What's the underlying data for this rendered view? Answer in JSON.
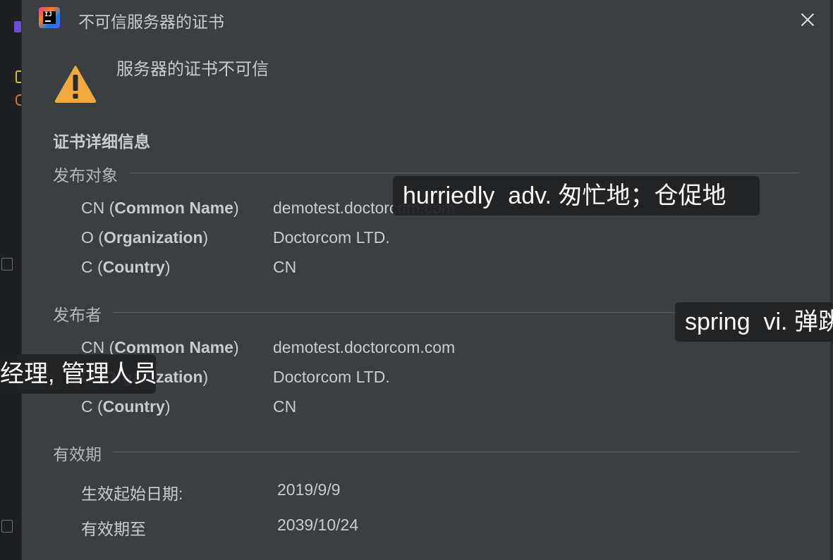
{
  "window": {
    "title": "不可信服务器的证书",
    "icon": "intellij-idea-logo",
    "close_icon": "close-icon",
    "logo_text": "IJ"
  },
  "message": {
    "icon": "warning-icon",
    "text": "服务器的证书不可信"
  },
  "details": {
    "heading": "证书详细信息",
    "subject": {
      "title": "发布对象",
      "rows": [
        {
          "key_prefix": "CN (",
          "key_bold": "Common Name",
          "key_suffix": ")",
          "value": "demotest.doctorcom.com"
        },
        {
          "key_prefix": "O (",
          "key_bold": "Organization",
          "key_suffix": ")",
          "value": "Doctorcom LTD."
        },
        {
          "key_prefix": "C (",
          "key_bold": "Country",
          "key_suffix": ")",
          "value": "CN"
        }
      ]
    },
    "issuer": {
      "title": "发布者",
      "rows": [
        {
          "key_prefix": "CN (",
          "key_bold": "Common Name",
          "key_suffix": ")",
          "value": "demotest.doctorcom.com"
        },
        {
          "key_prefix": "O (",
          "key_bold": "Organization",
          "key_suffix": ")",
          "value": "Doctorcom LTD."
        },
        {
          "key_prefix": "C (",
          "key_bold": "Country",
          "key_suffix": ")",
          "value": "CN"
        }
      ]
    },
    "validity": {
      "title": "有效期",
      "rows": [
        {
          "key": "生效起始日期:",
          "value": "2019/9/9"
        },
        {
          "key": "有效期至",
          "value": "2039/10/24"
        }
      ]
    }
  },
  "overlays": {
    "top": "hurriedly  adv. 匆忙地；仓促地",
    "right": "spring  vi. 弹跳",
    "left": "经理, 管理人员"
  }
}
